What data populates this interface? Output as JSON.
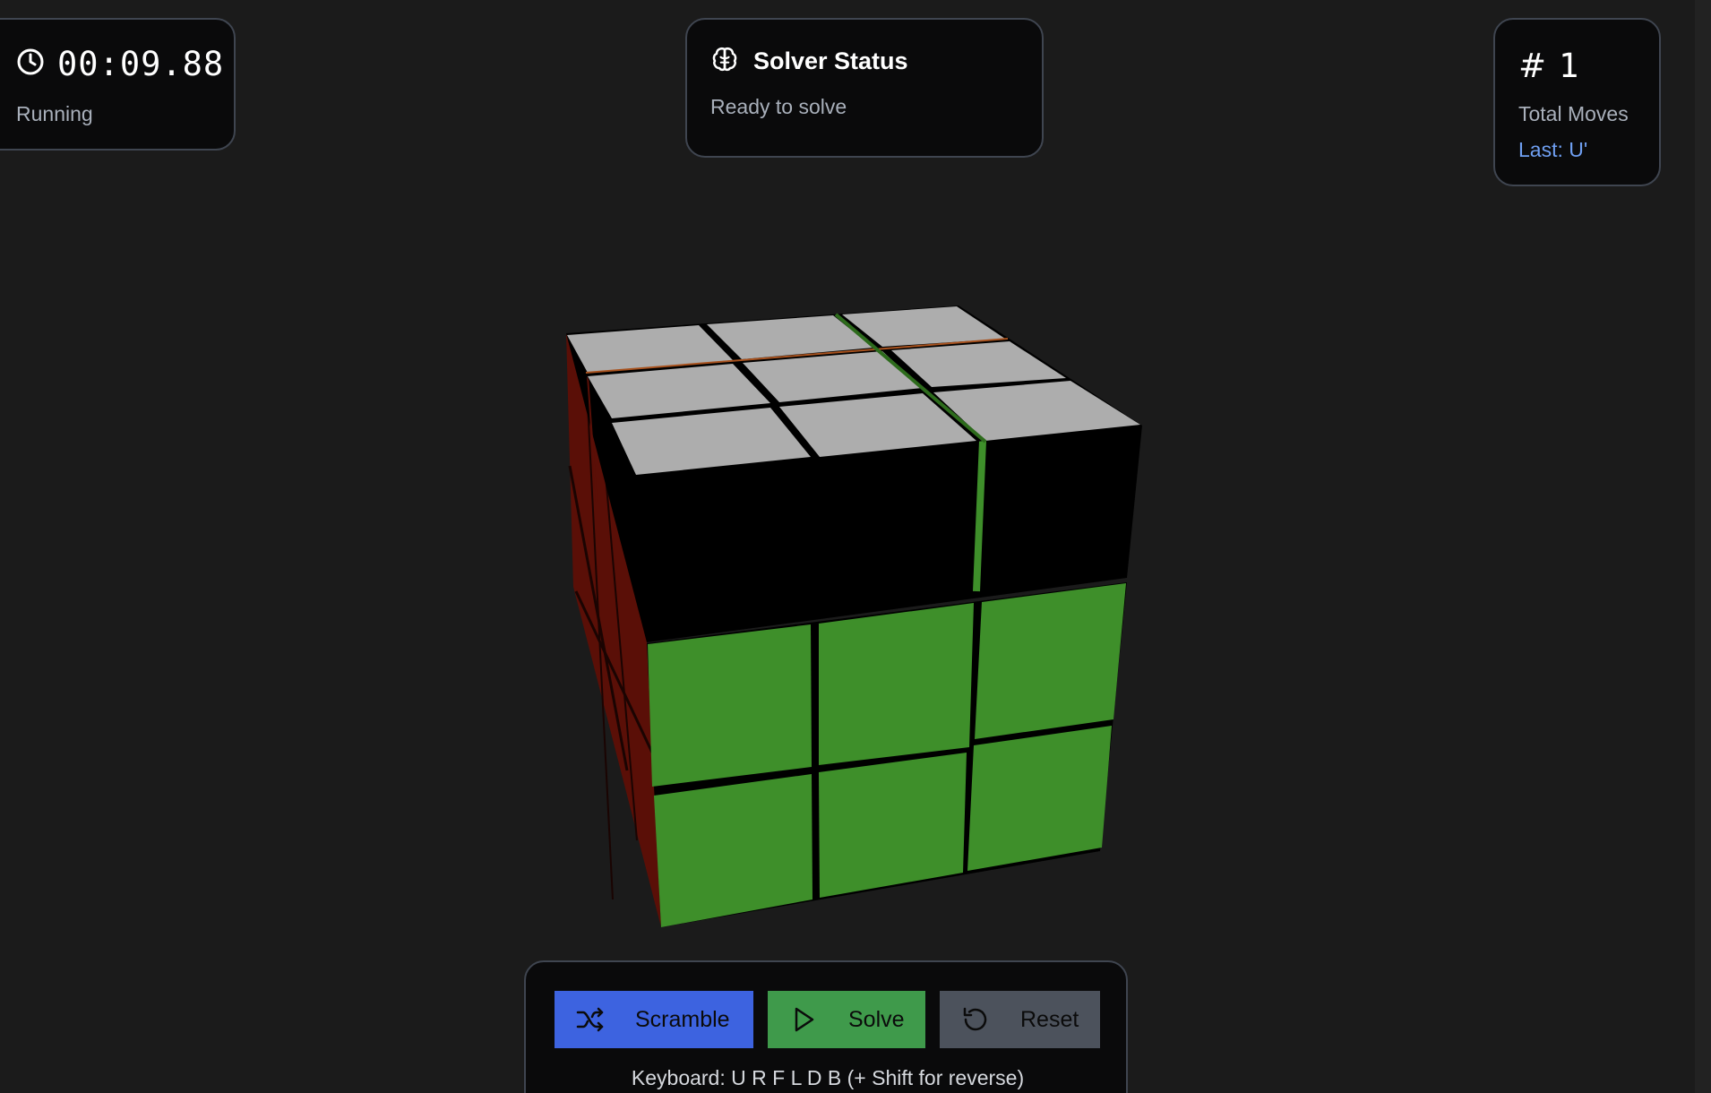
{
  "timer": {
    "value": "00:09.88",
    "state": "Running",
    "icon": "clock-icon"
  },
  "solver": {
    "title": "Solver Status",
    "status": "Ready to solve",
    "icon": "brain-icon"
  },
  "moves": {
    "symbol": "#",
    "count": "1",
    "label": "Total Moves",
    "last": "Last: U'"
  },
  "controls": {
    "scramble_label": "Scramble",
    "solve_label": "Solve",
    "reset_label": "Reset",
    "keyboard_hint": "Keyboard: U R F L D B (+ Shift for reverse)"
  },
  "colors": {
    "background": "#1b1b1b",
    "panel": "#0a0a0b",
    "panel_border": "#3f4550",
    "scramble": "#3d63e0",
    "solve": "#3f9a4b",
    "reset": "#4c525c",
    "last_move": "#6f9ff2",
    "cube_white": "#adadad",
    "cube_green": "#3e8f2a",
    "cube_red": "#5a0f07"
  }
}
